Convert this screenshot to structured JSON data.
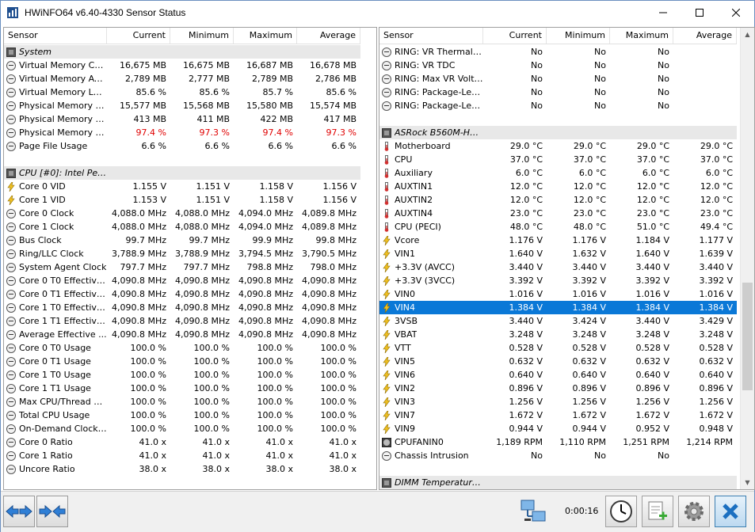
{
  "window": {
    "title": "HWiNFO64 v6.40-4330 Sensor Status"
  },
  "columns": {
    "sensor": "Sensor",
    "current": "Current",
    "minimum": "Minimum",
    "maximum": "Maximum",
    "average": "Average"
  },
  "left_rows": [
    {
      "type": "group",
      "icon": "chip-icon",
      "name": "System"
    },
    {
      "type": "row",
      "icon": "gauge-icon",
      "name": "Virtual Memory Com...",
      "current": "16,675 MB",
      "minimum": "16,675 MB",
      "maximum": "16,687 MB",
      "average": "16,678 MB"
    },
    {
      "type": "row",
      "icon": "gauge-icon",
      "name": "Virtual Memory Avai...",
      "current": "2,789 MB",
      "minimum": "2,777 MB",
      "maximum": "2,789 MB",
      "average": "2,786 MB"
    },
    {
      "type": "row",
      "icon": "gauge-icon",
      "name": "Virtual Memory Load",
      "current": "85.6 %",
      "minimum": "85.6 %",
      "maximum": "85.7 %",
      "average": "85.6 %"
    },
    {
      "type": "row",
      "icon": "gauge-icon",
      "name": "Physical Memory Used",
      "current": "15,577 MB",
      "minimum": "15,568 MB",
      "maximum": "15,580 MB",
      "average": "15,574 MB"
    },
    {
      "type": "row",
      "icon": "gauge-icon",
      "name": "Physical Memory Av...",
      "current": "413 MB",
      "minimum": "411 MB",
      "maximum": "422 MB",
      "average": "417 MB"
    },
    {
      "type": "row",
      "icon": "gauge-icon",
      "name": "Physical Memory Load",
      "current": "97.4 %",
      "minimum": "97.3 %",
      "maximum": "97.4 %",
      "average": "97.3 %",
      "warn": true
    },
    {
      "type": "row",
      "icon": "gauge-icon",
      "name": "Page File Usage",
      "current": "6.6 %",
      "minimum": "6.6 %",
      "maximum": "6.6 %",
      "average": "6.6 %"
    },
    {
      "type": "blank"
    },
    {
      "type": "group",
      "icon": "chip-icon",
      "name": "CPU [#0]: Intel Pen..."
    },
    {
      "type": "row",
      "icon": "lightning-icon",
      "name": "Core 0 VID",
      "current": "1.155 V",
      "minimum": "1.151 V",
      "maximum": "1.158 V",
      "average": "1.156 V"
    },
    {
      "type": "row",
      "icon": "lightning-icon",
      "name": "Core 1 VID",
      "current": "1.153 V",
      "minimum": "1.151 V",
      "maximum": "1.158 V",
      "average": "1.156 V"
    },
    {
      "type": "row",
      "icon": "gauge-icon",
      "name": "Core 0 Clock",
      "current": "4,088.0 MHz",
      "minimum": "4,088.0 MHz",
      "maximum": "4,094.0 MHz",
      "average": "4,089.8 MHz"
    },
    {
      "type": "row",
      "icon": "gauge-icon",
      "name": "Core 1 Clock",
      "current": "4,088.0 MHz",
      "minimum": "4,088.0 MHz",
      "maximum": "4,094.0 MHz",
      "average": "4,089.8 MHz"
    },
    {
      "type": "row",
      "icon": "gauge-icon",
      "name": "Bus Clock",
      "current": "99.7 MHz",
      "minimum": "99.7 MHz",
      "maximum": "99.9 MHz",
      "average": "99.8 MHz"
    },
    {
      "type": "row",
      "icon": "gauge-icon",
      "name": "Ring/LLC Clock",
      "current": "3,788.9 MHz",
      "minimum": "3,788.9 MHz",
      "maximum": "3,794.5 MHz",
      "average": "3,790.5 MHz"
    },
    {
      "type": "row",
      "icon": "gauge-icon",
      "name": "System Agent Clock",
      "current": "797.7 MHz",
      "minimum": "797.7 MHz",
      "maximum": "798.8 MHz",
      "average": "798.0 MHz"
    },
    {
      "type": "row",
      "icon": "gauge-icon",
      "name": "Core 0 T0 Effective...",
      "current": "4,090.8 MHz",
      "minimum": "4,090.8 MHz",
      "maximum": "4,090.8 MHz",
      "average": "4,090.8 MHz"
    },
    {
      "type": "row",
      "icon": "gauge-icon",
      "name": "Core 0 T1 Effective...",
      "current": "4,090.8 MHz",
      "minimum": "4,090.8 MHz",
      "maximum": "4,090.8 MHz",
      "average": "4,090.8 MHz"
    },
    {
      "type": "row",
      "icon": "gauge-icon",
      "name": "Core 1 T0 Effective...",
      "current": "4,090.8 MHz",
      "minimum": "4,090.8 MHz",
      "maximum": "4,090.8 MHz",
      "average": "4,090.8 MHz"
    },
    {
      "type": "row",
      "icon": "gauge-icon",
      "name": "Core 1 T1 Effective...",
      "current": "4,090.8 MHz",
      "minimum": "4,090.8 MHz",
      "maximum": "4,090.8 MHz",
      "average": "4,090.8 MHz"
    },
    {
      "type": "row",
      "icon": "gauge-icon",
      "name": "Average Effective ...",
      "current": "4,090.8 MHz",
      "minimum": "4,090.8 MHz",
      "maximum": "4,090.8 MHz",
      "average": "4,090.8 MHz"
    },
    {
      "type": "row",
      "icon": "gauge-icon",
      "name": "Core 0 T0 Usage",
      "current": "100.0 %",
      "minimum": "100.0 %",
      "maximum": "100.0 %",
      "average": "100.0 %"
    },
    {
      "type": "row",
      "icon": "gauge-icon",
      "name": "Core 0 T1 Usage",
      "current": "100.0 %",
      "minimum": "100.0 %",
      "maximum": "100.0 %",
      "average": "100.0 %"
    },
    {
      "type": "row",
      "icon": "gauge-icon",
      "name": "Core 1 T0 Usage",
      "current": "100.0 %",
      "minimum": "100.0 %",
      "maximum": "100.0 %",
      "average": "100.0 %"
    },
    {
      "type": "row",
      "icon": "gauge-icon",
      "name": "Core 1 T1 Usage",
      "current": "100.0 %",
      "minimum": "100.0 %",
      "maximum": "100.0 %",
      "average": "100.0 %"
    },
    {
      "type": "row",
      "icon": "gauge-icon",
      "name": "Max CPU/Thread U...",
      "current": "100.0 %",
      "minimum": "100.0 %",
      "maximum": "100.0 %",
      "average": "100.0 %"
    },
    {
      "type": "row",
      "icon": "gauge-icon",
      "name": "Total CPU Usage",
      "current": "100.0 %",
      "minimum": "100.0 %",
      "maximum": "100.0 %",
      "average": "100.0 %"
    },
    {
      "type": "row",
      "icon": "gauge-icon",
      "name": "On-Demand Clock ...",
      "current": "100.0 %",
      "minimum": "100.0 %",
      "maximum": "100.0 %",
      "average": "100.0 %"
    },
    {
      "type": "row",
      "icon": "gauge-icon",
      "name": "Core 0 Ratio",
      "current": "41.0 x",
      "minimum": "41.0 x",
      "maximum": "41.0 x",
      "average": "41.0 x"
    },
    {
      "type": "row",
      "icon": "gauge-icon",
      "name": "Core 1 Ratio",
      "current": "41.0 x",
      "minimum": "41.0 x",
      "maximum": "41.0 x",
      "average": "41.0 x"
    },
    {
      "type": "row",
      "icon": "gauge-icon",
      "name": "Uncore Ratio",
      "current": "38.0 x",
      "minimum": "38.0 x",
      "maximum": "38.0 x",
      "average": "38.0 x"
    }
  ],
  "right_rows": [
    {
      "type": "row",
      "icon": "gauge-icon",
      "name": "RING: VR Thermal ...",
      "current": "No",
      "minimum": "No",
      "maximum": "No",
      "average": ""
    },
    {
      "type": "row",
      "icon": "gauge-icon",
      "name": "RING: VR TDC",
      "current": "No",
      "minimum": "No",
      "maximum": "No",
      "average": ""
    },
    {
      "type": "row",
      "icon": "gauge-icon",
      "name": "RING: Max VR Volta...",
      "current": "No",
      "minimum": "No",
      "maximum": "No",
      "average": ""
    },
    {
      "type": "row",
      "icon": "gauge-icon",
      "name": "RING: Package-Lev...",
      "current": "No",
      "minimum": "No",
      "maximum": "No",
      "average": ""
    },
    {
      "type": "row",
      "icon": "gauge-icon",
      "name": "RING: Package-Lev...",
      "current": "No",
      "minimum": "No",
      "maximum": "No",
      "average": ""
    },
    {
      "type": "blank"
    },
    {
      "type": "group",
      "icon": "chip-icon",
      "name": "ASRock B560M-HDV..."
    },
    {
      "type": "row",
      "icon": "thermometer-icon",
      "name": "Motherboard",
      "current": "29.0 °C",
      "minimum": "29.0 °C",
      "maximum": "29.0 °C",
      "average": "29.0 °C"
    },
    {
      "type": "row",
      "icon": "thermometer-icon",
      "name": "CPU",
      "current": "37.0 °C",
      "minimum": "37.0 °C",
      "maximum": "37.0 °C",
      "average": "37.0 °C"
    },
    {
      "type": "row",
      "icon": "thermometer-icon",
      "name": "Auxiliary",
      "current": "6.0 °C",
      "minimum": "6.0 °C",
      "maximum": "6.0 °C",
      "average": "6.0 °C"
    },
    {
      "type": "row",
      "icon": "thermometer-icon",
      "name": "AUXTIN1",
      "current": "12.0 °C",
      "minimum": "12.0 °C",
      "maximum": "12.0 °C",
      "average": "12.0 °C"
    },
    {
      "type": "row",
      "icon": "thermometer-icon",
      "name": "AUXTIN2",
      "current": "12.0 °C",
      "minimum": "12.0 °C",
      "maximum": "12.0 °C",
      "average": "12.0 °C"
    },
    {
      "type": "row",
      "icon": "thermometer-icon",
      "name": "AUXTIN4",
      "current": "23.0 °C",
      "minimum": "23.0 °C",
      "maximum": "23.0 °C",
      "average": "23.0 °C"
    },
    {
      "type": "row",
      "icon": "thermometer-icon",
      "name": "CPU (PECI)",
      "current": "48.0 °C",
      "minimum": "48.0 °C",
      "maximum": "51.0 °C",
      "average": "49.4 °C"
    },
    {
      "type": "row",
      "icon": "lightning-icon",
      "name": "Vcore",
      "current": "1.176 V",
      "minimum": "1.176 V",
      "maximum": "1.184 V",
      "average": "1.177 V"
    },
    {
      "type": "row",
      "icon": "lightning-icon",
      "name": "VIN1",
      "current": "1.640 V",
      "minimum": "1.632 V",
      "maximum": "1.640 V",
      "average": "1.639 V"
    },
    {
      "type": "row",
      "icon": "lightning-icon",
      "name": "+3.3V (AVCC)",
      "current": "3.440 V",
      "minimum": "3.440 V",
      "maximum": "3.440 V",
      "average": "3.440 V"
    },
    {
      "type": "row",
      "icon": "lightning-icon",
      "name": "+3.3V (3VCC)",
      "current": "3.392 V",
      "minimum": "3.392 V",
      "maximum": "3.392 V",
      "average": "3.392 V"
    },
    {
      "type": "row",
      "icon": "lightning-icon",
      "name": "VIN0",
      "current": "1.016 V",
      "minimum": "1.016 V",
      "maximum": "1.016 V",
      "average": "1.016 V"
    },
    {
      "type": "row",
      "icon": "lightning-icon",
      "name": "VIN4",
      "current": "1.384 V",
      "minimum": "1.384 V",
      "maximum": "1.384 V",
      "average": "1.384 V",
      "selected": true
    },
    {
      "type": "row",
      "icon": "lightning-icon",
      "name": "3VSB",
      "current": "3.440 V",
      "minimum": "3.424 V",
      "maximum": "3.440 V",
      "average": "3.429 V"
    },
    {
      "type": "row",
      "icon": "lightning-icon",
      "name": "VBAT",
      "current": "3.248 V",
      "minimum": "3.248 V",
      "maximum": "3.248 V",
      "average": "3.248 V"
    },
    {
      "type": "row",
      "icon": "lightning-icon",
      "name": "VTT",
      "current": "0.528 V",
      "minimum": "0.528 V",
      "maximum": "0.528 V",
      "average": "0.528 V"
    },
    {
      "type": "row",
      "icon": "lightning-icon",
      "name": "VIN5",
      "current": "0.632 V",
      "minimum": "0.632 V",
      "maximum": "0.632 V",
      "average": "0.632 V"
    },
    {
      "type": "row",
      "icon": "lightning-icon",
      "name": "VIN6",
      "current": "0.640 V",
      "minimum": "0.640 V",
      "maximum": "0.640 V",
      "average": "0.640 V"
    },
    {
      "type": "row",
      "icon": "lightning-icon",
      "name": "VIN2",
      "current": "0.896 V",
      "minimum": "0.896 V",
      "maximum": "0.896 V",
      "average": "0.896 V"
    },
    {
      "type": "row",
      "icon": "lightning-icon",
      "name": "VIN3",
      "current": "1.256 V",
      "minimum": "1.256 V",
      "maximum": "1.256 V",
      "average": "1.256 V"
    },
    {
      "type": "row",
      "icon": "lightning-icon",
      "name": "VIN7",
      "current": "1.672 V",
      "minimum": "1.672 V",
      "maximum": "1.672 V",
      "average": "1.672 V"
    },
    {
      "type": "row",
      "icon": "lightning-icon",
      "name": "VIN9",
      "current": "0.944 V",
      "minimum": "0.944 V",
      "maximum": "0.952 V",
      "average": "0.948 V"
    },
    {
      "type": "row",
      "icon": "fan-icon",
      "name": "CPUFANIN0",
      "current": "1,189 RPM",
      "minimum": "1,110 RPM",
      "maximum": "1,251 RPM",
      "average": "1,214 RPM"
    },
    {
      "type": "row",
      "icon": "gauge-icon",
      "name": "Chassis Intrusion",
      "current": "No",
      "minimum": "No",
      "maximum": "No",
      "average": ""
    },
    {
      "type": "blank"
    },
    {
      "type": "group",
      "icon": "chip-icon",
      "name": "DIMM Temperature ..."
    }
  ],
  "bottom": {
    "timer": "0:00:16"
  },
  "colors": {
    "selection": "#0a78d7",
    "warning": "#e00000",
    "lightning": "#f0c020",
    "thermometer": "#d23030"
  }
}
